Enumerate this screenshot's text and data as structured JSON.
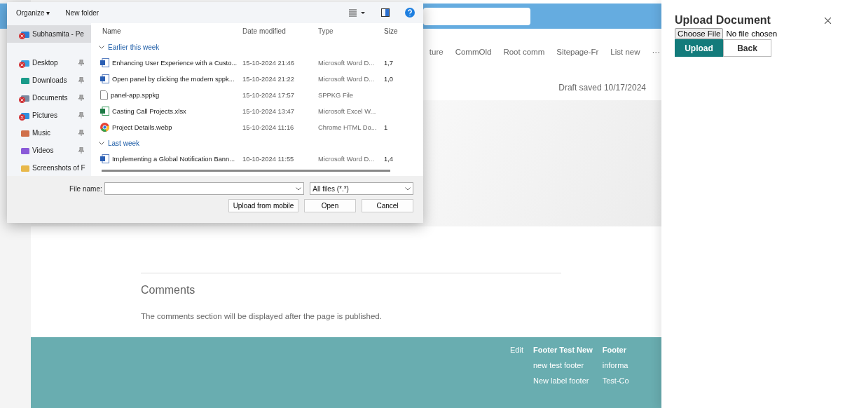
{
  "page": {
    "nav": [
      {
        "label": "ture"
      },
      {
        "label": "CommOld"
      },
      {
        "label": "Root comm"
      },
      {
        "label": "Sitepage-Fr"
      },
      {
        "label": "List new"
      },
      {
        "label": "···"
      }
    ],
    "draft_status": "Draft saved 10/17/2024",
    "comments": {
      "title": "Comments",
      "note": "The comments section will be displayed after the page is published."
    },
    "footer": {
      "edit": "Edit",
      "columns": [
        {
          "heading": "Footer Test New",
          "links": [
            "new test footer",
            "New label footer"
          ]
        },
        {
          "heading": "Footer",
          "links": [
            "informa",
            "Test-Co"
          ]
        }
      ]
    }
  },
  "file_dialog": {
    "toolbar": {
      "organize": "Organize ▾",
      "new_folder": "New folder"
    },
    "nav": [
      {
        "label": "Subhasmita - Pe",
        "kind": "cloud",
        "selected": true,
        "sync_error": true,
        "pinned": false
      },
      {
        "label": "Desktop",
        "kind": "desktop",
        "selected": false,
        "sync_error": true,
        "pinned": true
      },
      {
        "label": "Downloads",
        "kind": "download",
        "selected": false,
        "sync_error": false,
        "pinned": true
      },
      {
        "label": "Documents",
        "kind": "documents",
        "selected": false,
        "sync_error": true,
        "pinned": true
      },
      {
        "label": "Pictures",
        "kind": "pictures",
        "selected": false,
        "sync_error": true,
        "pinned": true
      },
      {
        "label": "Music",
        "kind": "music",
        "selected": false,
        "sync_error": false,
        "pinned": true
      },
      {
        "label": "Videos",
        "kind": "videos",
        "selected": false,
        "sync_error": false,
        "pinned": true
      },
      {
        "label": "Screenshots of F",
        "kind": "folder",
        "selected": false,
        "sync_error": false,
        "pinned": false
      }
    ],
    "columns": [
      "Name",
      "Date modified",
      "Type",
      "Size"
    ],
    "groups": [
      {
        "label": "Earlier this week",
        "files": [
          {
            "name": "Enhancing User Experience with a Custo...",
            "kind": "word",
            "date": "15-10-2024 21:46",
            "type": "Microsoft Word D...",
            "size": "1,7"
          },
          {
            "name": "Open panel by clicking the modern sppk...",
            "kind": "word",
            "date": "15-10-2024 21:22",
            "type": "Microsoft Word D...",
            "size": "1,0"
          },
          {
            "name": "panel-app.sppkg",
            "kind": "file",
            "date": "15-10-2024 17:57",
            "type": "SPPKG File"
          },
          {
            "name": "Casting Call Projects.xlsx",
            "kind": "excel",
            "date": "15-10-2024 13:47",
            "type": "Microsoft Excel W..."
          },
          {
            "name": "Project Details.webp",
            "kind": "chrome",
            "date": "15-10-2024 11:16",
            "type": "Chrome HTML Do...",
            "size": "1"
          }
        ]
      },
      {
        "label": "Last week",
        "files": [
          {
            "name": "Implementing a Global Notification Bann...",
            "kind": "word",
            "date": "10-10-2024 11:55",
            "type": "Microsoft Word D...",
            "size": "1,4"
          }
        ]
      }
    ],
    "file_name_label": "File name:",
    "file_type": "All files (*.*)",
    "buttons": [
      "Upload from mobile",
      "Open",
      "Cancel"
    ]
  },
  "panel": {
    "title": "Upload Document",
    "file_button": "Choose File",
    "file_status": "No file chosen",
    "buttons": [
      {
        "label": "Upload",
        "primary": true
      },
      {
        "label": "Back",
        "primary": false
      }
    ]
  }
}
